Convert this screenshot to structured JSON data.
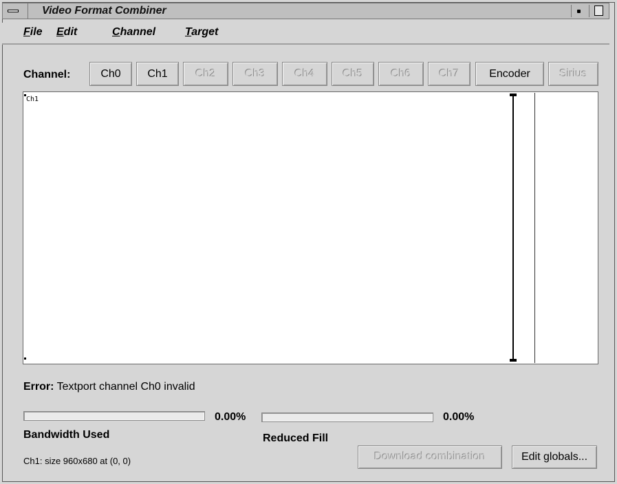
{
  "window": {
    "title": "Video Format Combiner"
  },
  "menu": {
    "items": [
      {
        "label": "File",
        "mnemonic": "F",
        "rest": "ile"
      },
      {
        "label": "Edit",
        "mnemonic": "E",
        "rest": "dit"
      },
      {
        "label": "Channel",
        "mnemonic": "C",
        "rest": "hannel"
      },
      {
        "label": "Target",
        "mnemonic": "T",
        "rest": "arget"
      }
    ]
  },
  "channel_bar": {
    "label": "Channel:",
    "buttons": [
      {
        "label": "Ch0",
        "enabled": true
      },
      {
        "label": "Ch1",
        "enabled": true
      },
      {
        "label": "Ch2",
        "enabled": false
      },
      {
        "label": "Ch3",
        "enabled": false
      },
      {
        "label": "Ch4",
        "enabled": false
      },
      {
        "label": "Ch5",
        "enabled": false
      },
      {
        "label": "Ch6",
        "enabled": false
      },
      {
        "label": "Ch7",
        "enabled": false
      },
      {
        "label": "Encoder",
        "enabled": true
      },
      {
        "label": "Sirius",
        "enabled": false
      }
    ]
  },
  "canvas": {
    "channel_label": "Ch1"
  },
  "error": {
    "label": "Error:",
    "message": "Textport channel Ch0 invalid"
  },
  "bandwidth": {
    "label": "Bandwidth Used",
    "value_text": "0.00%",
    "fraction": 0.0
  },
  "reduced_fill": {
    "label": "Reduced Fill",
    "value_text": "0.00%",
    "fraction": 0.0
  },
  "status": {
    "text": "Ch1: size 960x680 at (0, 0)"
  },
  "actions": {
    "download_label": "Download combination",
    "edit_globals_label": "Edit globals..."
  }
}
